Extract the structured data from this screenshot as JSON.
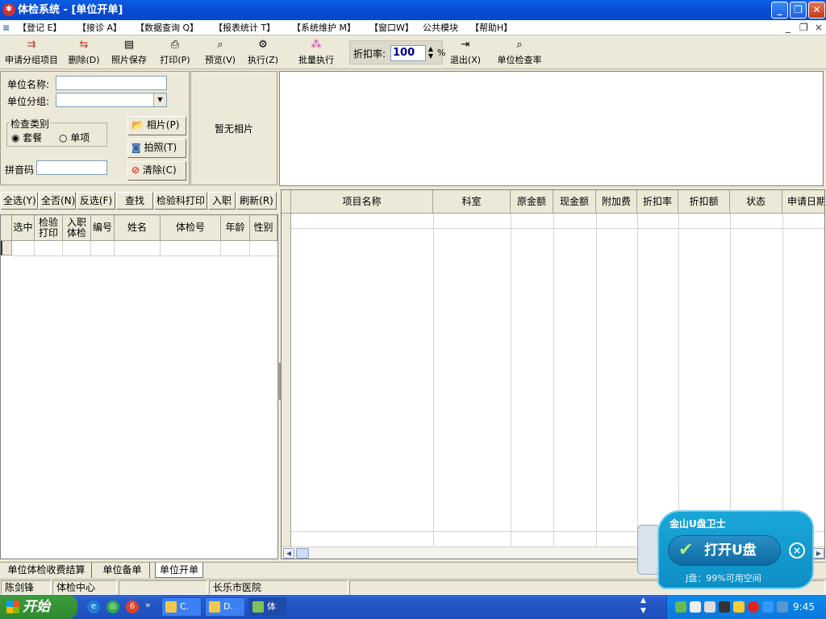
{
  "window": {
    "title": "体检系统 - [单位开单]",
    "buttons": {
      "minimize": "_",
      "restore": "❐",
      "close": "✕"
    }
  },
  "menubar": {
    "items": [
      "【登记 E】",
      "【接诊 A】",
      "【数据查询 Q】",
      "【报表统计 T】",
      "【系统维护 M】",
      "【窗口W】",
      "公共模块",
      "【帮助H】"
    ],
    "mdi_controls": [
      "_",
      "❐",
      "×"
    ]
  },
  "toolbar": {
    "items": [
      {
        "label": "申请分组项目",
        "icon": "group-add-icon"
      },
      {
        "label": "删除(D)",
        "icon": "delete-icon"
      },
      {
        "label": "照片保存",
        "icon": "save-photo-icon"
      },
      {
        "label": "打印(P)",
        "icon": "printer-icon"
      },
      {
        "label": "预览(V)",
        "icon": "preview-icon"
      },
      {
        "label": "执行(Z)",
        "icon": "gear-icon"
      },
      {
        "label": "批量执行",
        "icon": "batch-icon"
      },
      {
        "label": "退出(X)",
        "icon": "exit-icon"
      },
      {
        "label": "单位检查率",
        "icon": "search-icon"
      }
    ],
    "discount": {
      "label": "折扣率:",
      "value": "100",
      "unit": "%"
    }
  },
  "form": {
    "unit_name_label": "单位名称:",
    "unit_name_value": "",
    "unit_group_label": "单位分组:",
    "unit_group_value": "",
    "check_type_label": "检查类别",
    "check_type_options": [
      "套餐",
      "单项"
    ],
    "check_type_selected": "套餐",
    "pinyin_label": "拼音码",
    "pinyin_value": "",
    "photo_button": "相片(P)",
    "capture_button": "拍照(T)",
    "clear_button": "清除(C)",
    "no_photo_text": "暂无相片"
  },
  "left_toolbar": [
    "全选(Y)",
    "全否(N)",
    "反选(F)",
    "查找",
    "检验科打印",
    "入职",
    "刷新(R)"
  ],
  "left_grid": {
    "columns": [
      "选中",
      "检验打印",
      "入职体检",
      "编号",
      "姓名",
      "体检号",
      "年龄",
      "性别"
    ]
  },
  "right_grid": {
    "columns": [
      "项目名称",
      "科室",
      "原金额",
      "现金额",
      "附加费",
      "折扣率",
      "折扣额",
      "状态",
      "申请日期"
    ]
  },
  "tabs": {
    "items": [
      "单位体检收费结算",
      "单位备单",
      "单位开单"
    ],
    "active": "单位开单"
  },
  "statusbar": {
    "user": "陈剑锋",
    "department": "体检中心",
    "hospital": "长乐市医院"
  },
  "taskbar": {
    "start_label": "开始",
    "tasks": [
      "C.",
      "D.",
      "体"
    ],
    "clock": "9:45"
  },
  "popup": {
    "title": "金山U盘卫士",
    "button": "打开U盘",
    "space_text": "J盘：99%可用空间",
    "close": "×"
  },
  "colors": {
    "titlebar": "#0b4cd5",
    "window_bg": "#ece9d8",
    "discount_value": "#00008b",
    "popup_bg": "#1aa6d8"
  }
}
